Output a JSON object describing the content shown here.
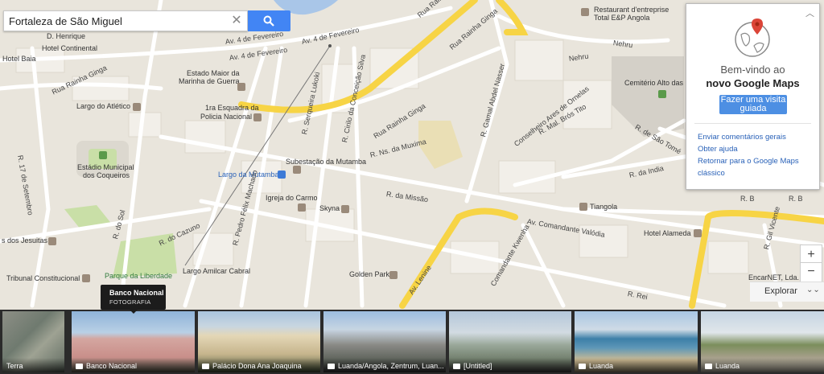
{
  "search": {
    "value": "Fortaleza de São Miguel"
  },
  "icons": {
    "clear": "close-icon",
    "search": "search-icon",
    "globe": "globe-pin-icon",
    "collapse": "chevron-up-icon",
    "explore": "double-chevron-down-icon",
    "camera": "camera-icon"
  },
  "colors": {
    "accent": "#4285f4",
    "major_road": "#f7d445",
    "land": "#e9e5dc",
    "park": "#c9dfa7",
    "water": "#a9c6e8"
  },
  "welcome": {
    "line1": "Bem-vindo ao",
    "line2": "novo Google Maps",
    "tour_button": "Fazer uma visita guiada",
    "links": [
      "Enviar comentários gerais",
      "Obter ajuda",
      "Retornar para o Google Maps",
      "clássico"
    ]
  },
  "controls": {
    "zoom_in": "+",
    "zoom_out": "−",
    "explore": "Explorar"
  },
  "map_labels": {
    "henrique": "D. Henrique",
    "hotel_continental": "Hotel Continental",
    "hotel_baia": "Hotel Baia",
    "estado_maior": "Estado Maior da",
    "marinha": "Marinha de Guerra",
    "largo_atletico": "Largo do Atlético",
    "esquadra": "1ra Esquadra da",
    "policia": "Policia Nacional",
    "estadio1": "Estádio Municipal",
    "estadio2": "dos Coqueiros",
    "subestacao": "Subestação da Mutamba",
    "largo_mutamba": "Largo da Mutamba",
    "igreja": "Igreja do Carmo",
    "skyna": "Skyna",
    "tiangola": "Tiangola",
    "hotel_alameda": "Hotel Alameda",
    "golden_park": "Golden Park",
    "largo_amilcar": "Largo Amilcar Cabral",
    "parque_liberdade": "Parque da Liberdade",
    "tribunal": "Tribunal Constitucional",
    "jesuitas": "s dos Jesuitas",
    "restaurant1": "Restaurant d'entreprise",
    "restaurant2": "Total E&P Angola",
    "cemiterio": "Cemitério Alto das C",
    "encarnet": "EncarNET, Lda."
  },
  "road_labels": {
    "fevereiro1": "Av. 4 de Fevereiro",
    "fevereiro2": "Av. 4 de Fevereiro",
    "fevereiro3": "Av. 4 de Fevereiro",
    "rainha1": "Rua Rainha Ginga",
    "rainha2": "Rua Rainha Ginga",
    "rainha3": "Rua Rainha Ginga",
    "rainha4": "Rua Rainha Ginga",
    "setembro": "R. 17 de Setembro",
    "lukoki": "R. Serqueira Lukoki",
    "conceicao": "R. Cirilo da Conceição Silva",
    "muxima": "R. Ns. da Muxima",
    "missao": "R. da Missão",
    "gamal": "R. Gamal Abdel Nasser",
    "nehru": "Nehru",
    "conselheiro": "Conselheiro Ares de Ornelas",
    "bros": "R. Mal. Brós Tito",
    "india": "R. da India",
    "sao_tome": "R. de São Tomé",
    "valodia": "Av. Comandante Valódia",
    "kwenha": "Comandante Kwenha",
    "lenine": "Av. Lenine",
    "gil_vicente": "R. Gil Vicente",
    "pedro_felix": "R. Pedro Félix Machado",
    "do_sol": "R. do Sol",
    "cazuno": "R. do Cazuno",
    "rb1": "R. B",
    "rb2": "R. B",
    "rei": "R. Rei"
  },
  "tooltip": {
    "title": "Banco Nacional",
    "subtitle": "FOTOGRAFIA"
  },
  "photos": [
    {
      "caption": "Terra",
      "camera": false
    },
    {
      "caption": "Banco Nacional",
      "camera": true
    },
    {
      "caption": "Palácio Dona Ana Joaquina",
      "camera": true
    },
    {
      "caption": "Luanda/Angola, Zentrum, Luan...",
      "camera": true
    },
    {
      "caption": "[Untitled]",
      "camera": true
    },
    {
      "caption": "Luanda",
      "camera": true
    },
    {
      "caption": "Luanda",
      "camera": true
    }
  ]
}
